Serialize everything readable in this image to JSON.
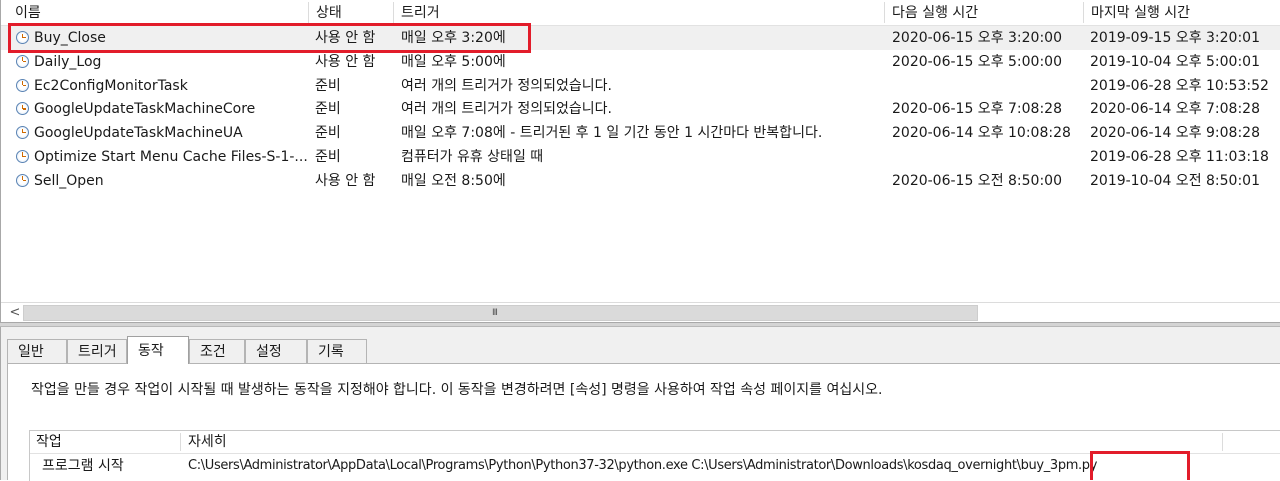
{
  "columns": {
    "name": "이름",
    "status": "상태",
    "trigger": "트리거",
    "next_run": "다음 실행 시간",
    "last_run": "마지막 실행 시간"
  },
  "tasks": [
    {
      "name": "Buy_Close",
      "status": "사용 안 함",
      "trigger": "매일 오후 3:20에",
      "next_run": "2020-06-15 오후 3:20:00",
      "last_run": "2019-09-15 오후 3:20:01"
    },
    {
      "name": "Daily_Log",
      "status": "사용 안 함",
      "trigger": "매일 오후 5:00에",
      "next_run": "2020-06-15 오후 5:00:00",
      "last_run": "2019-10-04 오후 5:00:01"
    },
    {
      "name": "Ec2ConfigMonitorTask",
      "status": "준비",
      "trigger": "여러 개의 트리거가 정의되었습니다.",
      "next_run": "",
      "last_run": "2019-06-28 오후 10:53:52"
    },
    {
      "name": "GoogleUpdateTaskMachineCore",
      "status": "준비",
      "trigger": "여러 개의 트리거가 정의되었습니다.",
      "next_run": "2020-06-15 오후 7:08:28",
      "last_run": "2020-06-14 오후 7:08:28"
    },
    {
      "name": "GoogleUpdateTaskMachineUA",
      "status": "준비",
      "trigger": "매일 오후 7:08에 - 트리거된 후 1 일 기간 동안 1 시간마다 반복합니다.",
      "next_run": "2020-06-14 오후 10:08:28",
      "last_run": "2020-06-14 오후 9:08:28"
    },
    {
      "name": "Optimize Start Menu Cache Files-S-1-...",
      "status": "준비",
      "trigger": "컴퓨터가 유휴 상태일 때",
      "next_run": "",
      "last_run": "2019-06-28 오후 11:03:18"
    },
    {
      "name": "Sell_Open",
      "status": "사용 안 함",
      "trigger": "매일 오전 8:50에",
      "next_run": "2020-06-15 오전 8:50:00",
      "last_run": "2019-10-04 오전 8:50:01"
    }
  ],
  "selected_task": "Buy_Close",
  "scrollbar": {
    "left_arrow": "<",
    "grip": "III"
  },
  "tabs": [
    "일반",
    "트리거",
    "동작",
    "조건",
    "설정",
    "기록"
  ],
  "active_tab": "동작",
  "actions_panel": {
    "description": "작업을 만들 경우 작업이 시작될 때 발생하는 동작을 지정해야 합니다. 이 동작을 변경하려면 [속성] 명령을 사용하여 작업 속성 페이지를 여십시오.",
    "columns": {
      "action": "작업",
      "details": "자세히"
    },
    "rows": [
      {
        "action": "프로그램 시작",
        "details_path": "C:\\Users\\Administrator\\AppData\\Local\\Programs\\Python\\Python37-32\\python.exe C:\\Users\\Administrator\\Downloads\\kosdaq_overnight",
        "details_file": "\\buy_3pm.py"
      }
    ]
  },
  "colors": {
    "highlight_border": "#e21c2a",
    "selected_row": "#f0f0f0",
    "clock_rim": "#5b84b4",
    "clock_hands": "#d06a00"
  },
  "icons": {
    "task": "clock-icon"
  }
}
